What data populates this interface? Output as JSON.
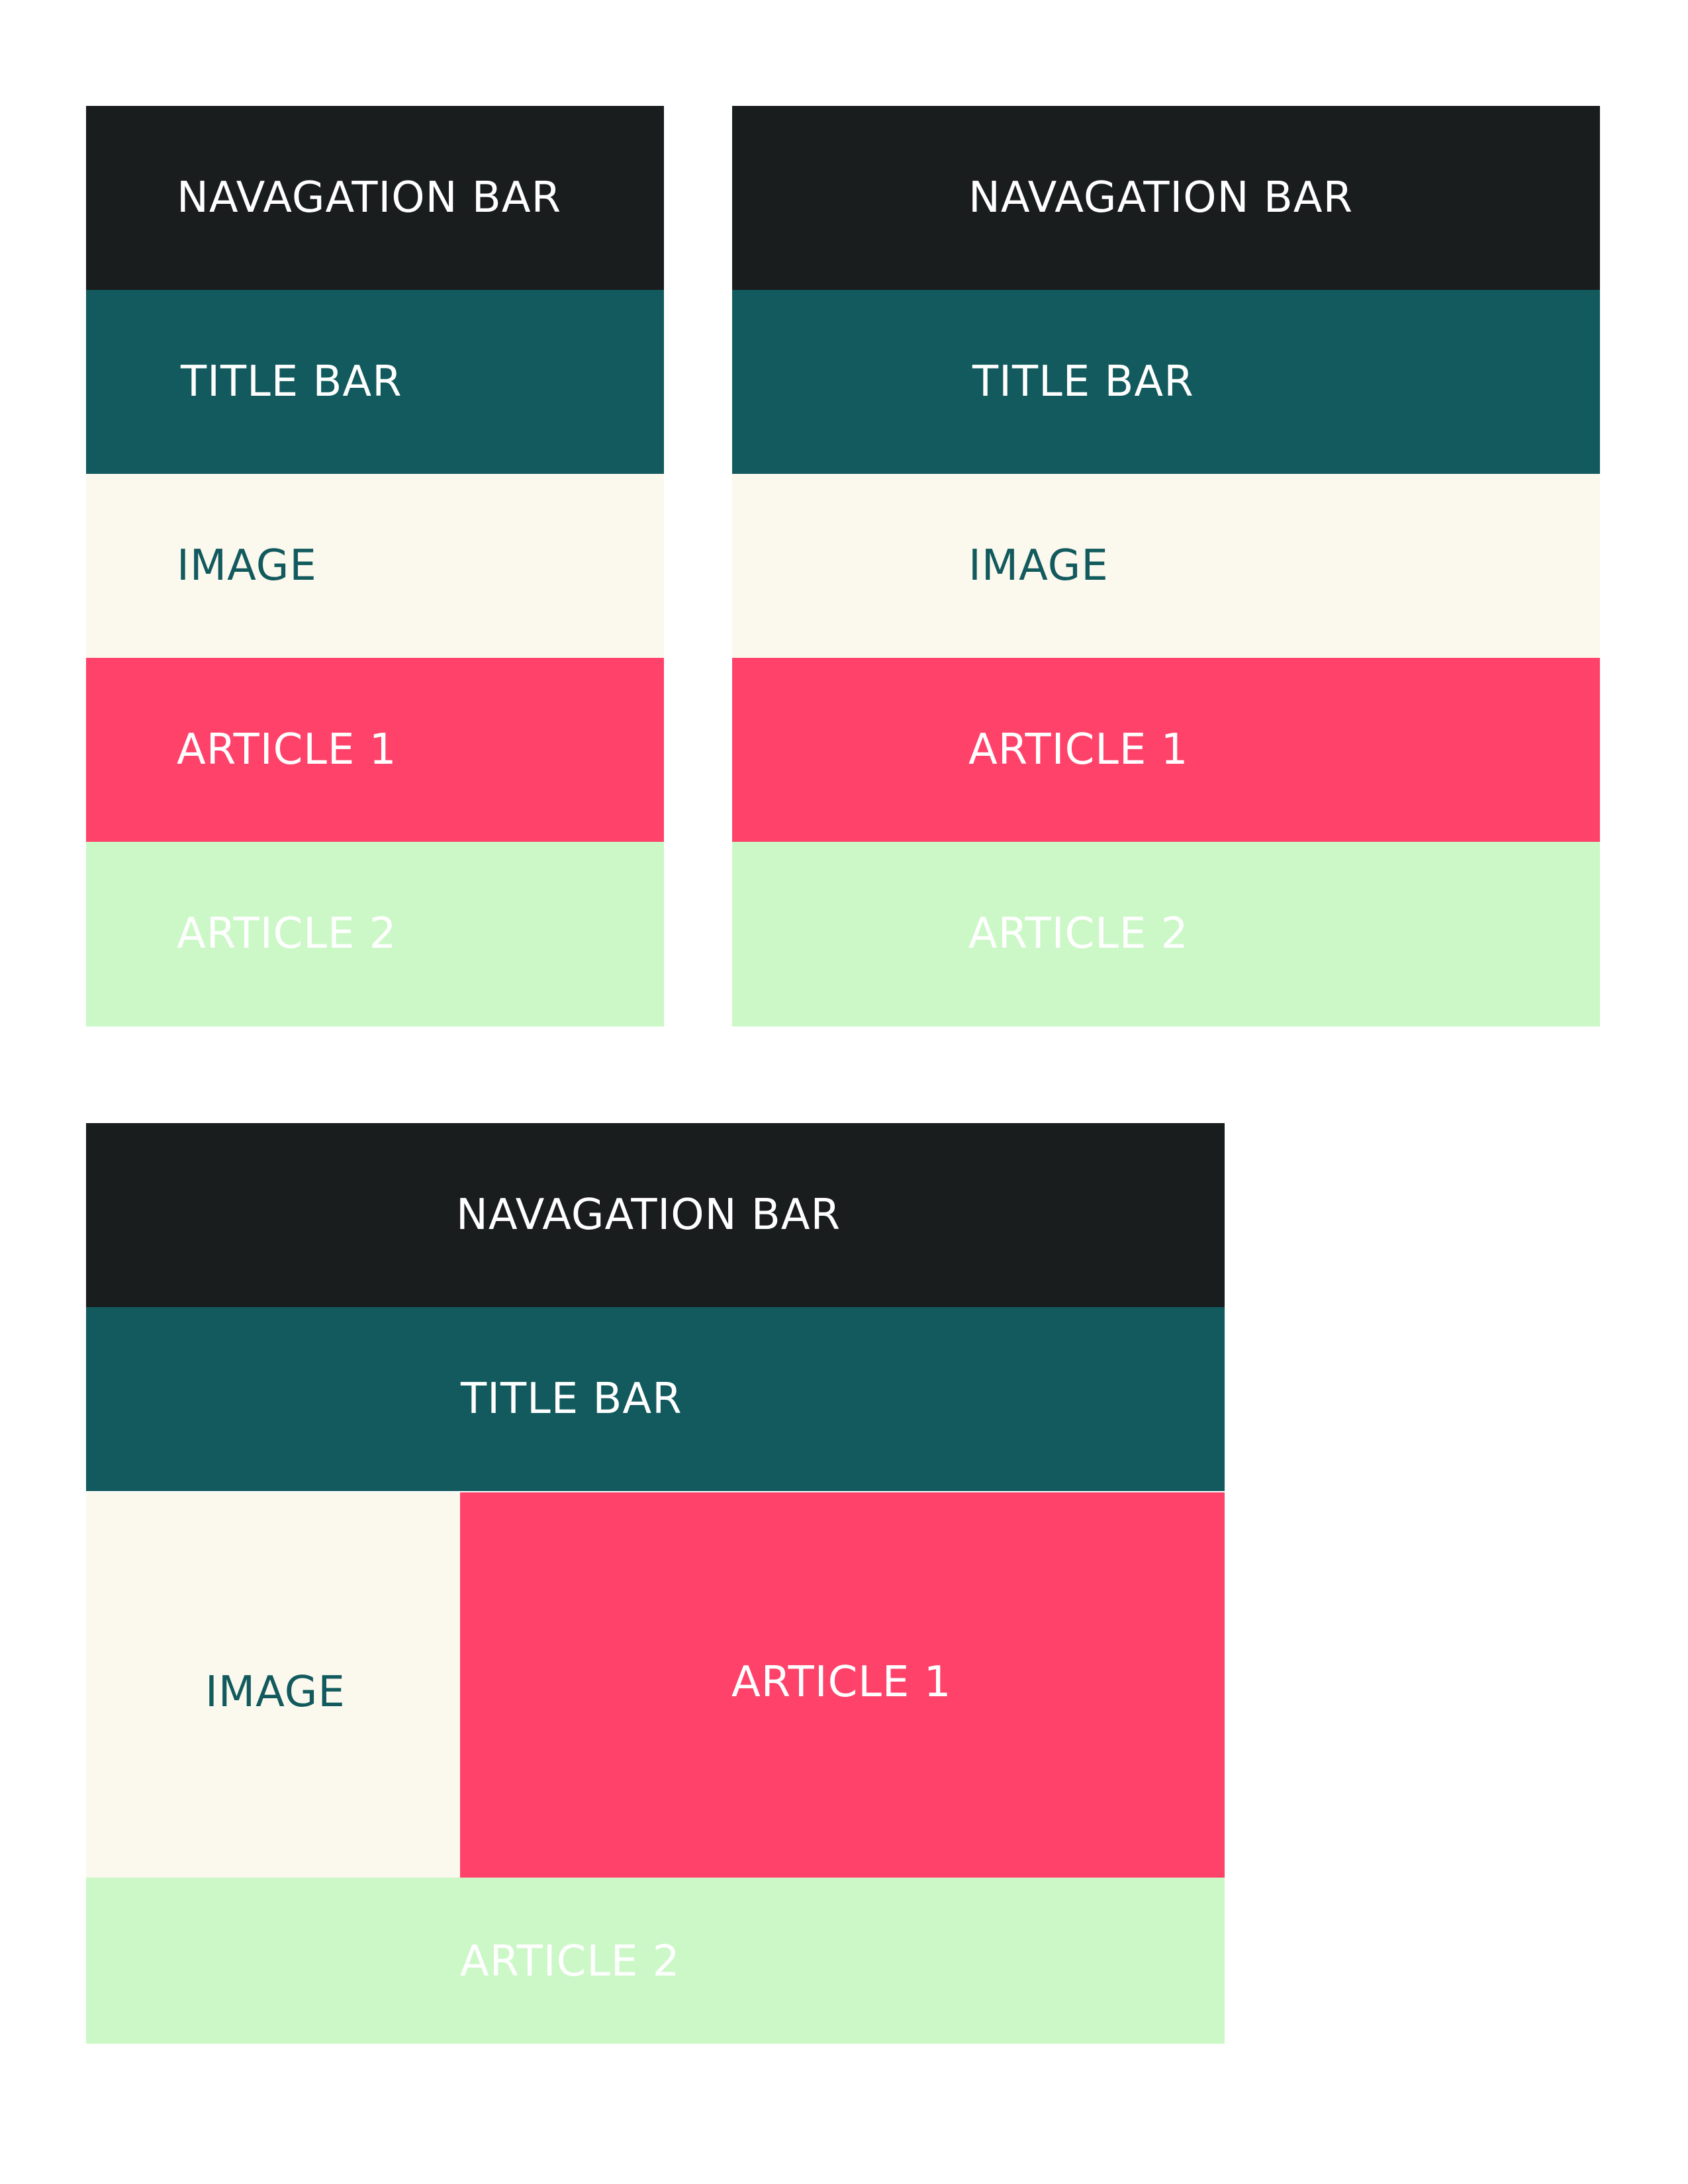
{
  "layouts": [
    {
      "blocks": {
        "navigation": "NAVAGATION BAR",
        "title": "TITLE BAR",
        "image": "IMAGE",
        "article1": "ARTICLE 1",
        "article2": "ARTICLE 2"
      }
    },
    {
      "blocks": {
        "navigation": "NAVAGATION BAR",
        "title": "TITLE BAR",
        "image": "IMAGE",
        "article1": "ARTICLE 1",
        "article2": "ARTICLE 2"
      }
    },
    {
      "blocks": {
        "navigation": "NAVAGATION BAR",
        "title": "TITLE BAR",
        "image": "IMAGE",
        "article1": "ARTICLE 1",
        "article2": "ARTICLE 2"
      }
    }
  ],
  "colors": {
    "navigation": "#191d1d",
    "title": "#125a5d",
    "image": "#fbf8ee",
    "article1": "#ff426a",
    "article2": "#ccf8c7",
    "image_text": "#125a5d",
    "light_text": "#ffffff"
  }
}
